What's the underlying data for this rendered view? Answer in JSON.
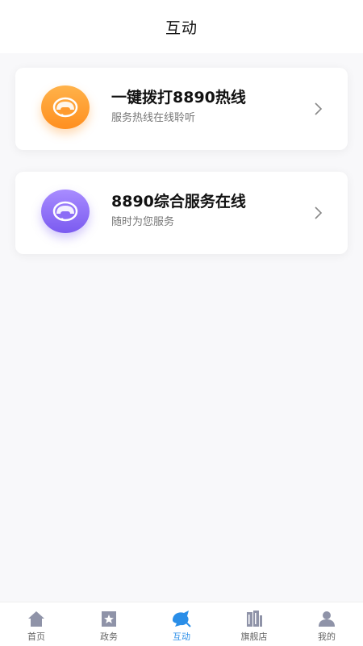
{
  "header": {
    "title": "互动"
  },
  "cards": [
    {
      "title": "一键拨打8890热线",
      "subtitle": "服务热线在线聆听",
      "icon": "headset-icon",
      "color": "#ff9a2e"
    },
    {
      "title": "8890综合服务在线",
      "subtitle": "随时为您服务",
      "icon": "headset-icon",
      "color": "#8b6cf6"
    }
  ],
  "tabbar": {
    "active": "互动",
    "active_color": "#2a8ee8",
    "items": [
      {
        "label": "首页",
        "icon": "home-icon"
      },
      {
        "label": "政务",
        "icon": "star-badge-icon"
      },
      {
        "label": "互动",
        "icon": "interaction-icon"
      },
      {
        "label": "旗舰店",
        "icon": "building-icon"
      },
      {
        "label": "我的",
        "icon": "user-icon"
      }
    ]
  }
}
